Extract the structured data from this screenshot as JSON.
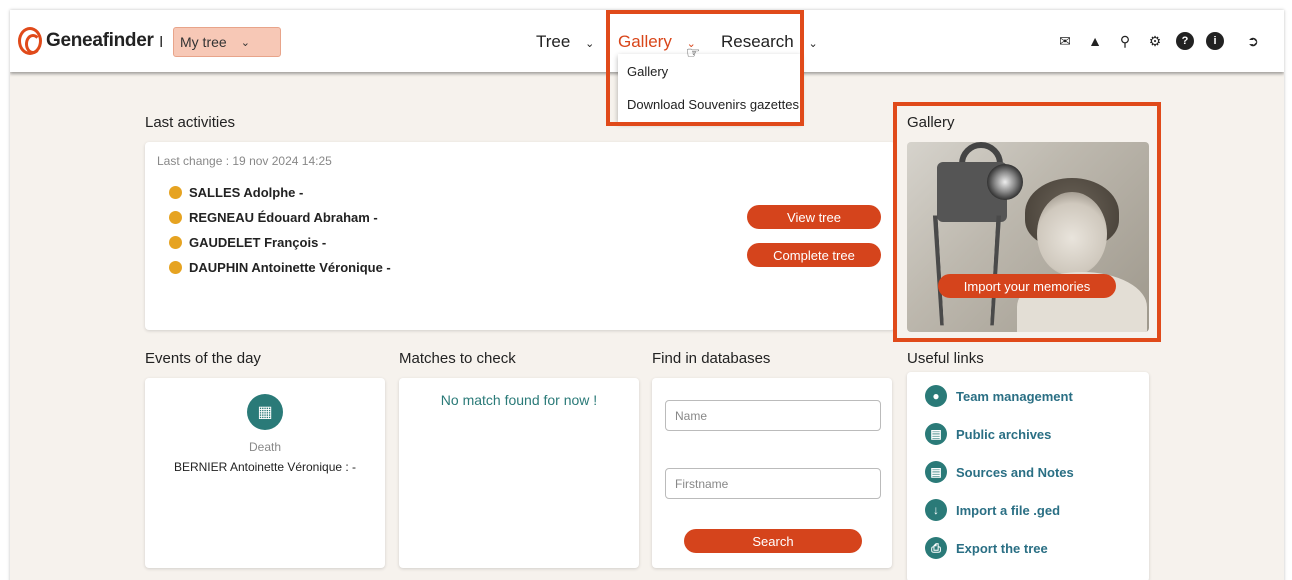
{
  "header": {
    "logo_text": "Geneafinder",
    "separator": "I",
    "tree_select": "My tree",
    "nav": [
      {
        "label": "Tree"
      },
      {
        "label": "Gallery"
      },
      {
        "label": "Research"
      }
    ],
    "gallery_dropdown": [
      "Gallery",
      "Download Souvenirs gazettes"
    ],
    "icons": [
      "mail-icon",
      "bell-icon",
      "search-icon",
      "gear-icon",
      "help-icon",
      "info-icon",
      "logout-icon"
    ]
  },
  "last_activities": {
    "title": "Last activities",
    "last_change": "Last change : 19 nov 2024 14:25",
    "persons": [
      "SALLES Adolphe -",
      "REGNEAU Édouard Abraham -",
      "GAUDELET François -",
      "DAUPHIN Antoinette Véronique -"
    ],
    "view_tree": "View tree",
    "complete_tree": "Complete tree"
  },
  "gallery": {
    "title": "Gallery",
    "import_button": "Import your memories"
  },
  "events": {
    "title": "Events of the day",
    "event_type": "Death",
    "event_person": "BERNIER Antoinette Véronique : -"
  },
  "matches": {
    "title": "Matches to check",
    "empty_text": "No match found for now !"
  },
  "find": {
    "title": "Find in databases",
    "name_placeholder": "Name",
    "firstname_placeholder": "Firstname",
    "search_button": "Search"
  },
  "useful_links": {
    "title": "Useful links",
    "items": [
      "Team management",
      "Public archives",
      "Sources and Notes",
      "Import a file .ged",
      "Export the tree"
    ]
  },
  "colors": {
    "accent": "#d5441c",
    "teal": "#2a7a78",
    "highlight": "#e04a1a"
  }
}
